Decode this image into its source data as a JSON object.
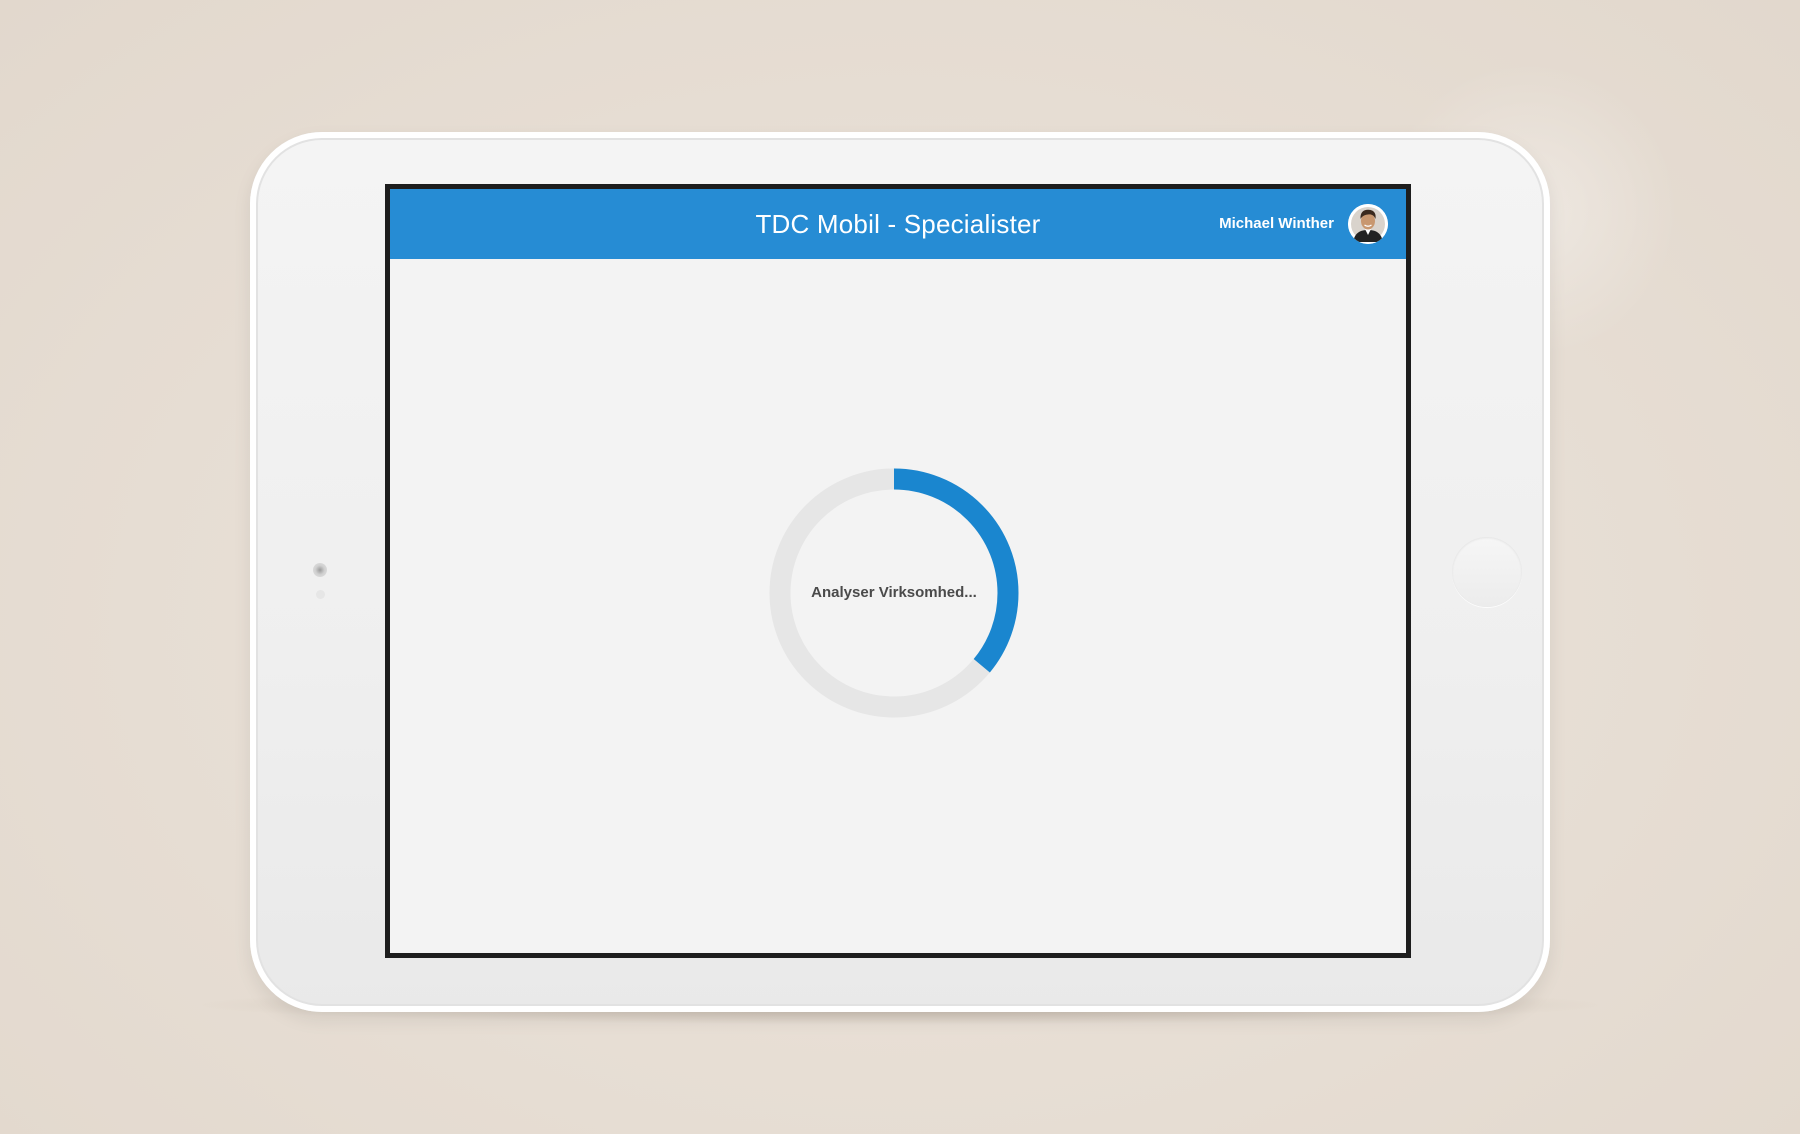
{
  "app": {
    "title": "TDC Mobil - Specialister"
  },
  "user": {
    "name": "Michael Winther",
    "avatar_icon": "user-avatar-icon"
  },
  "loader": {
    "label": "Analyser Virksomhed...",
    "progress": 0.36
  },
  "colors": {
    "accent": "#268cd4",
    "loader_track": "#e6e6e6",
    "loader_fill": "#1a86cf",
    "screen_background": "#f3f3f3",
    "page_background": "#e6ddd3"
  }
}
